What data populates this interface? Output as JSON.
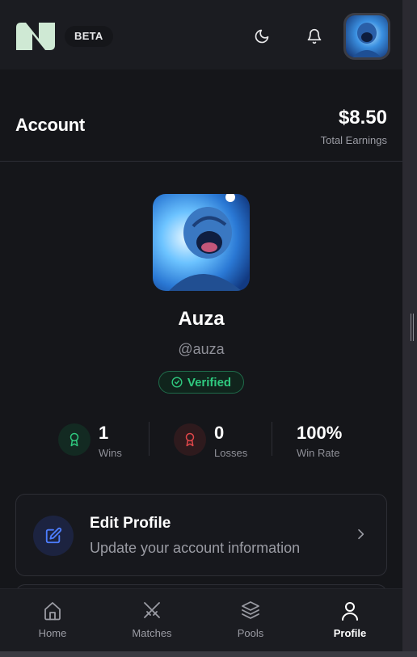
{
  "app": {
    "beta_label": "BETA",
    "colors": {
      "background": "#15161a",
      "header": "#1b1c21",
      "accent_green": "#2fc97f",
      "accent_red": "#e0474a",
      "accent_blue": "#4d7dff",
      "logo": "#cfe9d4"
    }
  },
  "header": {
    "icons": [
      "logo-icon",
      "moon-icon",
      "bell-icon",
      "avatar"
    ]
  },
  "account": {
    "title": "Account",
    "earnings_amount": "$8.50",
    "earnings_label": "Total Earnings"
  },
  "profile": {
    "display_name": "Auza",
    "username": "@auza",
    "verified_label": "Verified"
  },
  "stats": {
    "wins": {
      "value": "1",
      "label": "Wins"
    },
    "losses": {
      "value": "0",
      "label": "Losses"
    },
    "win_rate": {
      "value": "100%",
      "label": "Win Rate"
    }
  },
  "edit_card": {
    "title": "Edit Profile",
    "subtitle": "Update your account information"
  },
  "nav": {
    "items": [
      {
        "label": "Home",
        "icon": "home-icon"
      },
      {
        "label": "Matches",
        "icon": "swords-icon"
      },
      {
        "label": "Pools",
        "icon": "layers-icon"
      },
      {
        "label": "Profile",
        "icon": "user-icon",
        "active": true
      }
    ]
  }
}
